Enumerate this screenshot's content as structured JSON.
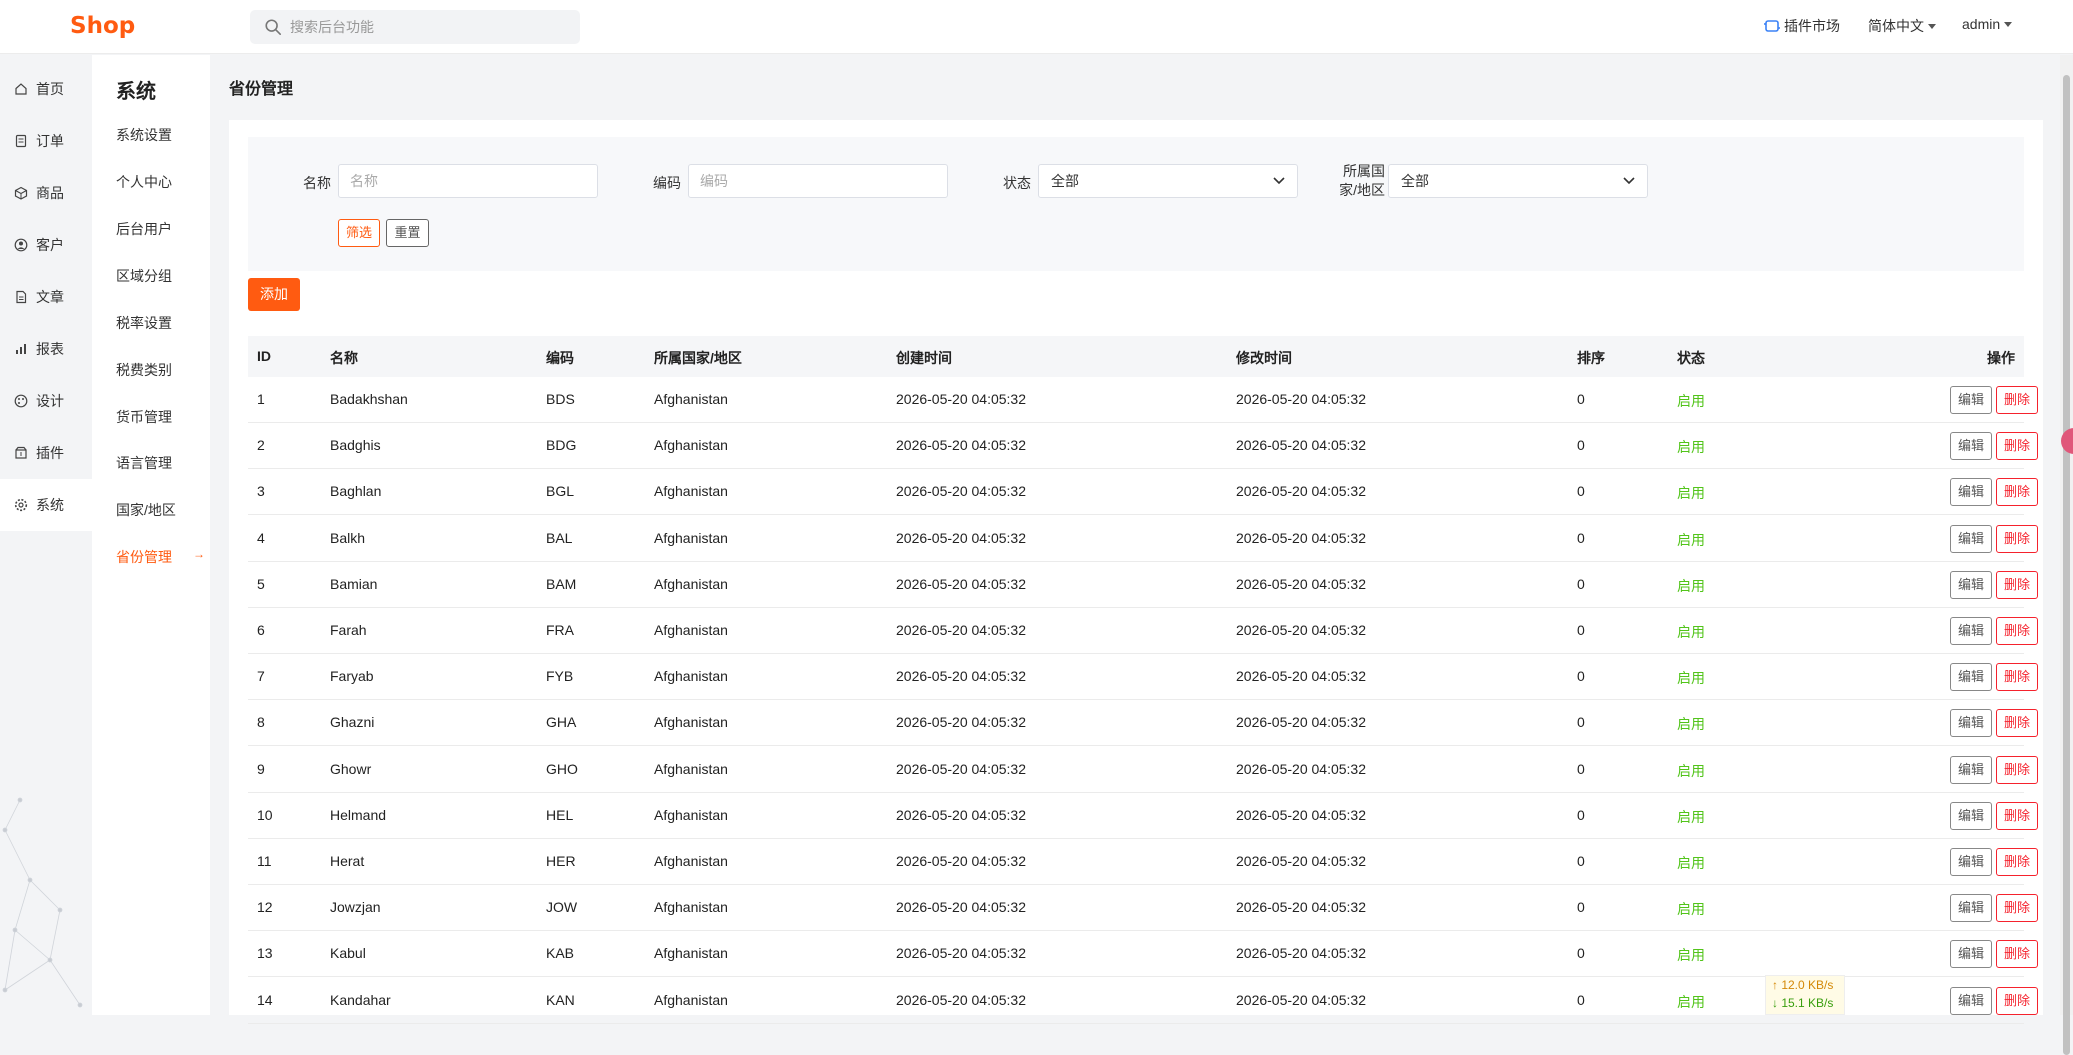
{
  "header": {
    "logo": "Shop",
    "search_placeholder": "搜索后台功能",
    "plugin_market": "插件市场",
    "language": "简体中文",
    "user": "admin"
  },
  "sidebar": {
    "items": [
      {
        "label": "首页",
        "icon": "home-icon"
      },
      {
        "label": "订单",
        "icon": "order-icon"
      },
      {
        "label": "商品",
        "icon": "box-icon"
      },
      {
        "label": "客户",
        "icon": "user-icon"
      },
      {
        "label": "文章",
        "icon": "document-icon"
      },
      {
        "label": "报表",
        "icon": "chart-icon"
      },
      {
        "label": "设计",
        "icon": "palette-icon"
      },
      {
        "label": "插件",
        "icon": "plugin-icon"
      },
      {
        "label": "系统",
        "icon": "gear-icon"
      }
    ],
    "active": "系统"
  },
  "subnav": {
    "title": "系统",
    "items": [
      "系统设置",
      "个人中心",
      "后台用户",
      "区域分组",
      "税率设置",
      "税费类别",
      "货币管理",
      "语言管理",
      "国家/地区",
      "省份管理"
    ],
    "active": "省份管理"
  },
  "page": {
    "title": "省份管理"
  },
  "filter": {
    "name_label": "名称",
    "name_placeholder": "名称",
    "code_label": "编码",
    "code_placeholder": "编码",
    "status_label": "状态",
    "status_value": "全部",
    "country_label": "所属国家/地区",
    "country_value": "全部",
    "filter_button": "筛选",
    "reset_button": "重置"
  },
  "add_button": "添加",
  "table": {
    "columns": [
      "ID",
      "名称",
      "编码",
      "所属国家/地区",
      "创建时间",
      "修改时间",
      "排序",
      "状态",
      "操作"
    ],
    "edit_label": "编辑",
    "delete_label": "删除",
    "rows": [
      {
        "id": "1",
        "name": "Badakhshan",
        "code": "BDS",
        "country": "Afghanistan",
        "created": "2026-05-20 04:05:32",
        "updated": "2026-05-20 04:05:32",
        "sort": "0",
        "status": "启用"
      },
      {
        "id": "2",
        "name": "Badghis",
        "code": "BDG",
        "country": "Afghanistan",
        "created": "2026-05-20 04:05:32",
        "updated": "2026-05-20 04:05:32",
        "sort": "0",
        "status": "启用"
      },
      {
        "id": "3",
        "name": "Baghlan",
        "code": "BGL",
        "country": "Afghanistan",
        "created": "2026-05-20 04:05:32",
        "updated": "2026-05-20 04:05:32",
        "sort": "0",
        "status": "启用"
      },
      {
        "id": "4",
        "name": "Balkh",
        "code": "BAL",
        "country": "Afghanistan",
        "created": "2026-05-20 04:05:32",
        "updated": "2026-05-20 04:05:32",
        "sort": "0",
        "status": "启用"
      },
      {
        "id": "5",
        "name": "Bamian",
        "code": "BAM",
        "country": "Afghanistan",
        "created": "2026-05-20 04:05:32",
        "updated": "2026-05-20 04:05:32",
        "sort": "0",
        "status": "启用"
      },
      {
        "id": "6",
        "name": "Farah",
        "code": "FRA",
        "country": "Afghanistan",
        "created": "2026-05-20 04:05:32",
        "updated": "2026-05-20 04:05:32",
        "sort": "0",
        "status": "启用"
      },
      {
        "id": "7",
        "name": "Faryab",
        "code": "FYB",
        "country": "Afghanistan",
        "created": "2026-05-20 04:05:32",
        "updated": "2026-05-20 04:05:32",
        "sort": "0",
        "status": "启用"
      },
      {
        "id": "8",
        "name": "Ghazni",
        "code": "GHA",
        "country": "Afghanistan",
        "created": "2026-05-20 04:05:32",
        "updated": "2026-05-20 04:05:32",
        "sort": "0",
        "status": "启用"
      },
      {
        "id": "9",
        "name": "Ghowr",
        "code": "GHO",
        "country": "Afghanistan",
        "created": "2026-05-20 04:05:32",
        "updated": "2026-05-20 04:05:32",
        "sort": "0",
        "status": "启用"
      },
      {
        "id": "10",
        "name": "Helmand",
        "code": "HEL",
        "country": "Afghanistan",
        "created": "2026-05-20 04:05:32",
        "updated": "2026-05-20 04:05:32",
        "sort": "0",
        "status": "启用"
      },
      {
        "id": "11",
        "name": "Herat",
        "code": "HER",
        "country": "Afghanistan",
        "created": "2026-05-20 04:05:32",
        "updated": "2026-05-20 04:05:32",
        "sort": "0",
        "status": "启用"
      },
      {
        "id": "12",
        "name": "Jowzjan",
        "code": "JOW",
        "country": "Afghanistan",
        "created": "2026-05-20 04:05:32",
        "updated": "2026-05-20 04:05:32",
        "sort": "0",
        "status": "启用"
      },
      {
        "id": "13",
        "name": "Kabul",
        "code": "KAB",
        "country": "Afghanistan",
        "created": "2026-05-20 04:05:32",
        "updated": "2026-05-20 04:05:32",
        "sort": "0",
        "status": "启用"
      },
      {
        "id": "14",
        "name": "Kandahar",
        "code": "KAN",
        "country": "Afghanistan",
        "created": "2026-05-20 04:05:32",
        "updated": "2026-05-20 04:05:32",
        "sort": "0",
        "status": "启用"
      }
    ]
  },
  "netspeed": {
    "up": "↑ 12.0 KB/s",
    "down": "↓ 15.1 KB/s"
  },
  "colors": {
    "brand": "#ff5b11",
    "enabled": "#52c41a",
    "danger": "#f5222d"
  }
}
